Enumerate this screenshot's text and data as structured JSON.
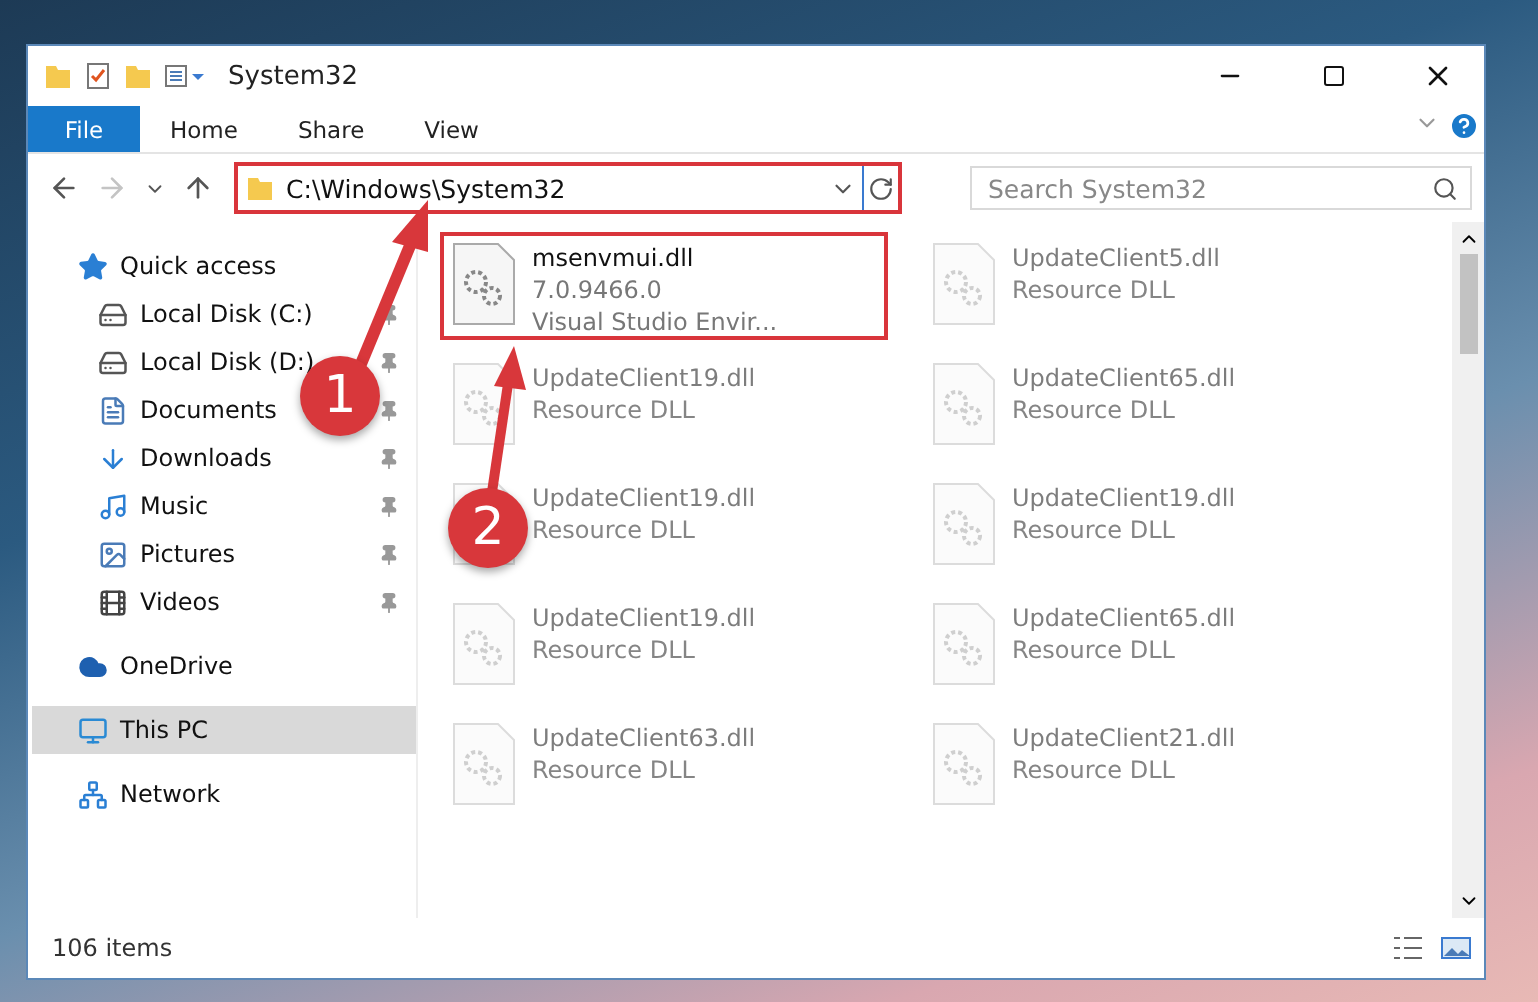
{
  "window": {
    "title": "System32"
  },
  "ribbon": {
    "tabs": [
      {
        "label": "File",
        "selected": true
      },
      {
        "label": "Home",
        "selected": false
      },
      {
        "label": "Share",
        "selected": false
      },
      {
        "label": "View",
        "selected": false
      }
    ]
  },
  "address_bar": {
    "path": "C:\\Windows\\System32",
    "highlighted": true,
    "forward_disabled": true
  },
  "search": {
    "placeholder": "Search System32"
  },
  "sidebar": {
    "items": [
      {
        "label": "Quick access",
        "selected": false,
        "children": [
          {
            "label": "Local Disk (C:)",
            "pinned": true,
            "selected": false
          },
          {
            "label": "Local Disk (D:)",
            "pinned": true,
            "selected": false
          },
          {
            "label": "Documents",
            "pinned": true,
            "selected": false
          },
          {
            "label": "Downloads",
            "pinned": true,
            "selected": false
          },
          {
            "label": "Music",
            "pinned": true,
            "selected": false
          },
          {
            "label": "Pictures",
            "pinned": true,
            "selected": false
          },
          {
            "label": "Videos",
            "pinned": true,
            "selected": false
          }
        ]
      },
      {
        "label": "OneDrive",
        "selected": false
      },
      {
        "label": "This PC",
        "selected": true
      },
      {
        "label": "Network",
        "selected": false
      }
    ]
  },
  "files": [
    {
      "name": "msenvmui.dll",
      "lines": [
        "7.0.9466.0",
        "Visual Studio Envir..."
      ],
      "highlighted": true,
      "blurred": false
    },
    {
      "name": "UpdateClient5.dll",
      "lines": [
        "Resource DLL"
      ],
      "highlighted": false,
      "blurred": true
    },
    {
      "name": "UpdateClient19.dll",
      "lines": [
        "Resource DLL"
      ],
      "highlighted": false,
      "blurred": true
    },
    {
      "name": "UpdateClient65.dll",
      "lines": [
        "Resource DLL"
      ],
      "highlighted": false,
      "blurred": true
    },
    {
      "name": "UpdateClient19.dll",
      "lines": [
        "Resource DLL"
      ],
      "highlighted": false,
      "blurred": true
    },
    {
      "name": "UpdateClient19.dll",
      "lines": [
        "Resource DLL"
      ],
      "highlighted": false,
      "blurred": true
    },
    {
      "name": "UpdateClient19.dll",
      "lines": [
        "Resource DLL"
      ],
      "highlighted": false,
      "blurred": true
    },
    {
      "name": "UpdateClient65.dll",
      "lines": [
        "Resource DLL"
      ],
      "highlighted": false,
      "blurred": true
    },
    {
      "name": "UpdateClient63.dll",
      "lines": [
        "Resource DLL"
      ],
      "highlighted": false,
      "blurred": true
    },
    {
      "name": "UpdateClient21.dll",
      "lines": [
        "Resource DLL"
      ],
      "highlighted": false,
      "blurred": true
    }
  ],
  "annotations": [
    {
      "number": "1"
    },
    {
      "number": "2"
    }
  ],
  "status_bar": {
    "item_count": "106 items"
  }
}
